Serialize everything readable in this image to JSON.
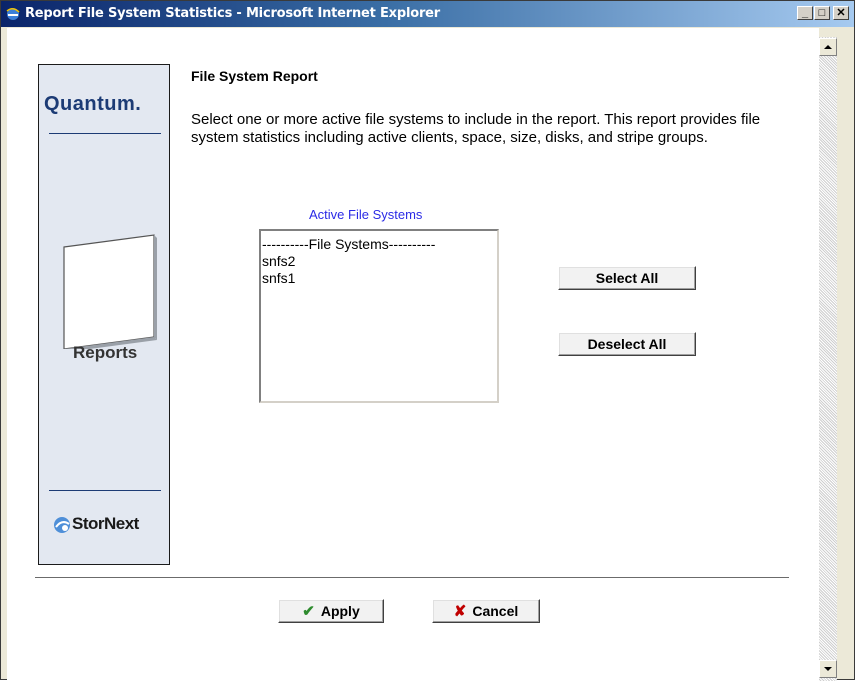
{
  "window": {
    "title": "Report File System Statistics - Microsoft Internet Explorer",
    "minimize_label": "_",
    "maximize_label": "□",
    "close_label": "✕"
  },
  "sidebar": {
    "brand": "Quantum.",
    "section": "Reports",
    "product": "StorNext"
  },
  "main": {
    "heading": "File System Report",
    "description": "Select one or more active file systems to include in the report. This report provides file system statistics including active clients, space, size, disks, and stripe groups.",
    "list_label": "Active File Systems",
    "list_options": [
      "----------File Systems----------",
      "snfs2",
      "snfs1"
    ],
    "select_all_label": "Select All",
    "deselect_all_label": "Deselect All"
  },
  "footer": {
    "apply_label": "Apply",
    "cancel_label": "Cancel"
  },
  "colors": {
    "title_gradient_start": "#0a246a",
    "brand_blue": "#1c3b75",
    "list_label_blue": "#2b2be6",
    "apply_green": "#2e8b2e",
    "cancel_red": "#c00000"
  },
  "icons": {
    "window": "ie-icon",
    "brand_globe": "stornext-globe-icon",
    "apply": "checkmark-icon",
    "cancel": "x-icon"
  }
}
